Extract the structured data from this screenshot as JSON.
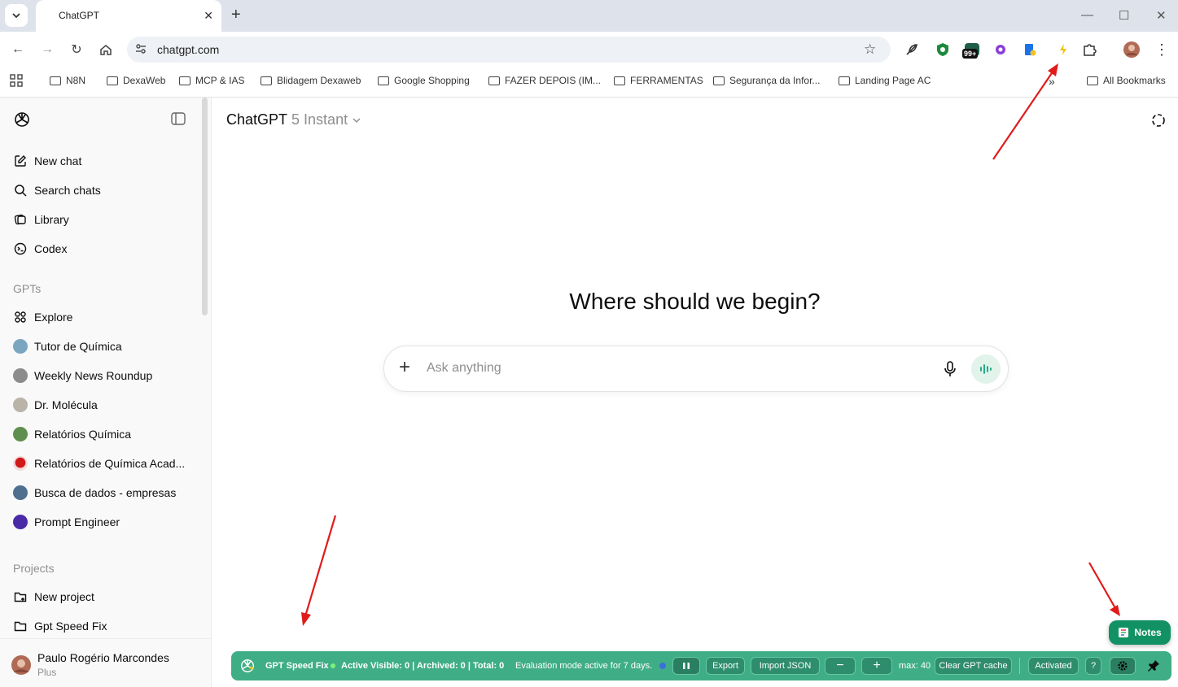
{
  "browser": {
    "tab_title": "ChatGPT",
    "url": "chatgpt.com",
    "bookmarks": [
      "N8N",
      "DexaWeb",
      "MCP & IAS",
      "Blidagem Dexaweb",
      "Google Shopping",
      "FAZER DEPOIS (IM...",
      "FERRAMENTAS",
      "Segurança da Infor...",
      "Landing Page AC"
    ],
    "all_bookmarks": "All Bookmarks",
    "badge": "99+"
  },
  "sidebar": {
    "items": [
      "New chat",
      "Search chats",
      "Library",
      "Codex"
    ],
    "gpts_label": "GPTs",
    "gpts": [
      {
        "label": "Explore"
      },
      {
        "label": "Tutor de Química",
        "color": "#7aa6c2"
      },
      {
        "label": "Weekly News Roundup",
        "color": "#8c8c8c"
      },
      {
        "label": "Dr. Molécula",
        "color": "#b9b3a8"
      },
      {
        "label": "Relatórios Química",
        "color": "#5f8f4e"
      },
      {
        "label": "Relatórios de Química Acad...",
        "color": "#d01818"
      },
      {
        "label": "Busca de dados - empresas",
        "color": "#4f6f8f"
      },
      {
        "label": "Prompt Engineer",
        "color": "#4b2aa8"
      }
    ],
    "projects_label": "Projects",
    "projects": [
      "New project",
      "Gpt Speed Fix"
    ],
    "user": {
      "name": "Paulo Rogério Marcondes",
      "plan": "Plus"
    }
  },
  "main": {
    "model_name": "ChatGPT",
    "model_variant": "5 Instant",
    "headline": "Where should we begin?",
    "composer_placeholder": "Ask anything"
  },
  "notes": {
    "label": "Notes"
  },
  "speedbar": {
    "title": "GPT Speed Fix",
    "status": "Active",
    "counts": "Visible: 0 | Archived: 0 | Total: 0",
    "eval": "Evaluation mode active for 7 days.",
    "export": "Export",
    "import": "Import JSON",
    "minus": "−",
    "plus": "+",
    "max": "max: 40",
    "clear": "Clear GPT cache",
    "activated": "Activated",
    "help": "?"
  },
  "colors": {
    "accent": "#10a37f",
    "speedbar": "#3fae86",
    "notes": "#129264",
    "arrow": "#e01b1b"
  }
}
